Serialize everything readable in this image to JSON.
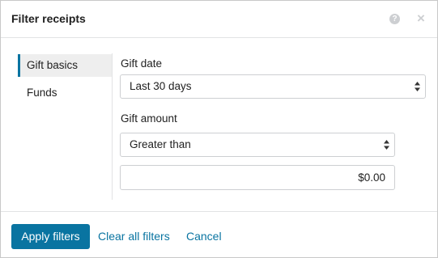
{
  "dialog": {
    "title": "Filter receipts",
    "help_icon": "question-circle-icon",
    "close_icon": "close-x-icon"
  },
  "tabs": [
    {
      "label": "Gift basics",
      "active": true
    },
    {
      "label": "Funds",
      "active": false
    }
  ],
  "gift_date": {
    "label": "Gift date",
    "selected": "Last 30 days"
  },
  "gift_amount": {
    "label": "Gift amount",
    "comparison_selected": "Greater than",
    "value": "$0.00"
  },
  "footer": {
    "apply_label": "Apply filters",
    "clear_label": "Clear all filters",
    "cancel_label": "Cancel"
  },
  "colors": {
    "accent": "#0974a1",
    "border": "#cdcfd2",
    "active_tab_bg": "#eeeeee"
  }
}
